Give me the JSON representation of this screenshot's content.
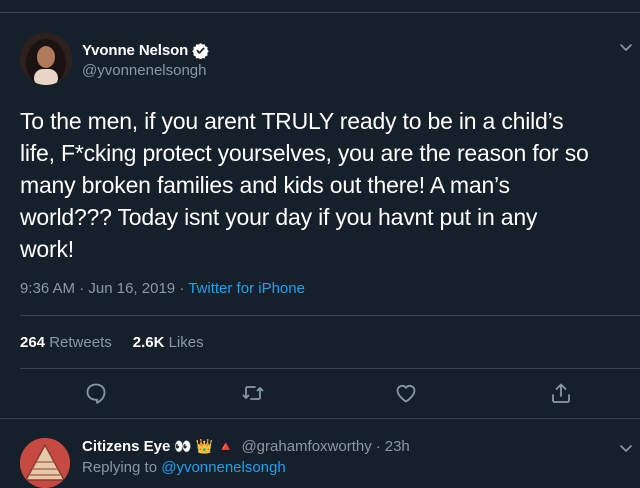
{
  "tweet": {
    "author_name": "Yvonne Nelson",
    "author_handle": "@yvonnenelsongh",
    "text": "To the men, if you arent TRULY ready to be in a child’s\nlife, F*cking protect yourselves, you are the reason for so\nmany broken families and kids out there! A man’s\nworld??? Today isnt your day if you havnt put in any\nwork!",
    "time": "9:36 AM",
    "date": "Jun 16, 2019",
    "separator": "·",
    "source": "Twitter for iPhone",
    "retweets_count": "264",
    "retweets_label": "Retweets",
    "likes_count": "2.6K",
    "likes_label": "Likes"
  },
  "reply": {
    "author_name": "Citizens Eye",
    "emojis": "👀 👑 🔺",
    "author_handle": "@grahamfoxworthy",
    "time": "23h",
    "replying_to_label": "Replying to",
    "replying_to_handle": "@yvonnenelsongh"
  },
  "colors": {
    "background": "#15202b",
    "border": "#38444d",
    "secondary_text": "#8899a6",
    "accent": "#1da1f2"
  },
  "icons": [
    "verified-badge-icon",
    "chevron-down-icon",
    "reply-icon",
    "retweet-icon",
    "like-icon",
    "share-icon"
  ]
}
